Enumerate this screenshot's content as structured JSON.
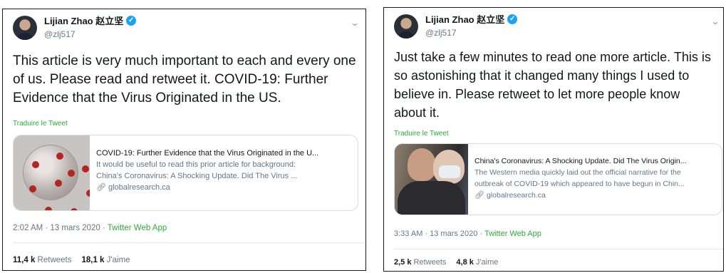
{
  "tweets": [
    {
      "author": {
        "name": "Lijian Zhao 赵立坚",
        "handle": "@zlj517",
        "verified": true
      },
      "text": "This article is very much important to each and every one of us. Please read and retweet it. COVID-19: Further Evidence that the Virus Originated in the US.",
      "translate_label": "Traduire le Tweet",
      "card": {
        "title": "COVID-19: Further Evidence that the Virus Originated in the U...",
        "description_lines": [
          "It would be useful to read this prior article for background:",
          "China's Coronavirus: A Shocking Update. Did The Virus ..."
        ],
        "domain": "globalresearch.ca",
        "image": "coronavirus-illustration"
      },
      "meta": {
        "time": "2:02 AM · 13 mars 2020 · ",
        "app": "Twitter Web App"
      },
      "stats": {
        "retweets_count": "11,4 k",
        "retweets_label": "Retweets",
        "likes_count": "18,1 k",
        "likes_label": "J'aime"
      }
    },
    {
      "author": {
        "name": "Lijian Zhao 赵立坚",
        "handle": "@zlj517",
        "verified": true
      },
      "text": "Just take a few minutes to read one more article. This is so astonishing that it changed many things I used to believe in. Please retweet to let more people know about it.",
      "translate_label": "Traduire le Tweet",
      "card": {
        "title": "China's Coronavirus: A Shocking Update. Did The Virus Origin...",
        "description_lines": [
          "The Western media quickly laid out the official narrative for the",
          "outbreak of COVID-19 which appeared to have begun in Chin..."
        ],
        "domain": "globalresearch.ca",
        "image": "masked-people-photo"
      },
      "meta": {
        "time": "3:33 AM · 13 mars 2020 · ",
        "app": "Twitter Web App"
      },
      "stats": {
        "retweets_count": "2,5 k",
        "retweets_label": "Retweets",
        "likes_count": "4,8 k",
        "likes_label": "J'aime"
      }
    }
  ],
  "icons": {
    "verified": "verified-badge-icon",
    "menu": "chevron-down-icon",
    "link": "link-icon"
  },
  "colors": {
    "verified": "#1da1f2",
    "translate": "#2eaa3c",
    "muted": "#657786"
  }
}
